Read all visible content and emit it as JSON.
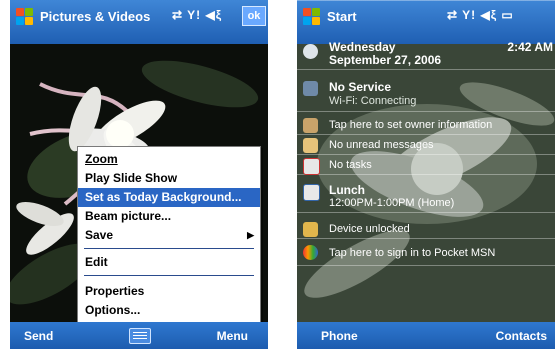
{
  "left_screen": {
    "title": "Pictures & Videos",
    "status_icons": "⇄ Y! ◀ξ",
    "ok_label": "ok",
    "menu_items": [
      {
        "label": "Zoom",
        "has_submenu": false
      },
      {
        "label": "Play Slide Show",
        "has_submenu": false
      },
      {
        "label": "Set as Today Background...",
        "has_submenu": false,
        "selected": true
      },
      {
        "label": "Beam picture...",
        "has_submenu": false
      },
      {
        "label": "Save",
        "has_submenu": true
      },
      {
        "label": "Edit",
        "has_submenu": false
      },
      {
        "label": "Properties",
        "has_submenu": false
      },
      {
        "label": "Options...",
        "has_submenu": false
      }
    ],
    "submenu_arrow": "▶",
    "softkey_left": "Send",
    "softkey_right": "Menu"
  },
  "right_screen": {
    "title": "Start",
    "status_icons": "⇄ Y! ◀ξ ▭",
    "date_weekday": "Wednesday",
    "date_full": "September 27, 2006",
    "time": "2:42 AM",
    "service": "No Service",
    "wifi": "Wi-Fi: Connecting",
    "owner": "Tap here to set owner information",
    "messages": "No unread messages",
    "tasks": "No tasks",
    "appointment_title": "Lunch",
    "appointment_time": "12:00PM-1:00PM (Home)",
    "device": "Device unlocked",
    "msn": "Tap here to sign in to Pocket MSN",
    "softkey_left": "Phone",
    "softkey_right": "Contacts"
  },
  "colors": {
    "titlebar": "#2a6fc4",
    "menu_highlight": "#2a66c4",
    "softbar": "#2469c0"
  }
}
